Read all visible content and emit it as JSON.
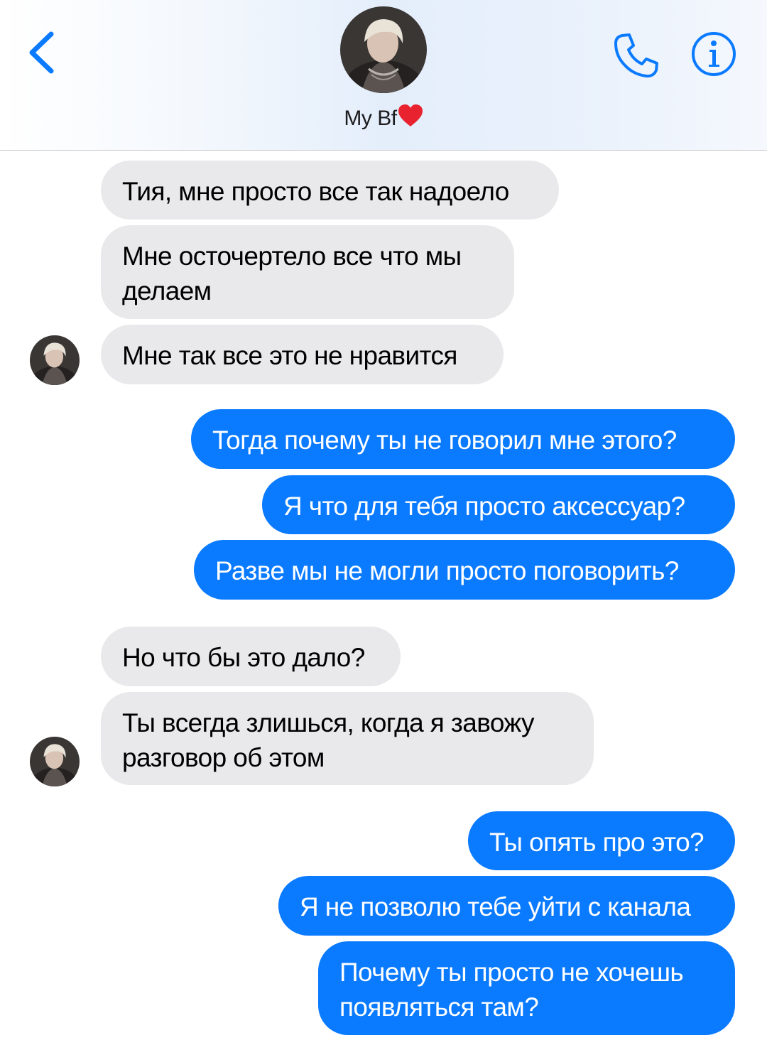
{
  "header": {
    "contact_name": "My Bf",
    "back_icon": "chevron-left-icon",
    "call_icon": "phone-icon",
    "info_icon": "info-icon",
    "accent": "#0a7aff"
  },
  "messages": [
    {
      "from": "contact",
      "text": "Тия, мне просто все так надоело"
    },
    {
      "from": "contact",
      "line1": "Мне осточертело все что мы",
      "line2": "делаем"
    },
    {
      "from": "contact",
      "text": "Мне так все это не нравится"
    },
    {
      "from": "me",
      "text": "Тогда почему ты не говорил мне этого?"
    },
    {
      "from": "me",
      "text": "Я что для тебя просто аксессуар?"
    },
    {
      "from": "me",
      "text": "Разве мы не могли просто поговорить?"
    },
    {
      "from": "contact",
      "text": "Но что бы это дало?"
    },
    {
      "from": "contact",
      "line1": "Ты всегда злишься, когда я завожу",
      "line2": "разговор об этом"
    },
    {
      "from": "me",
      "text": "Ты опять про это?"
    },
    {
      "from": "me",
      "text": "Я не позволю тебе уйти с канала"
    },
    {
      "from": "me",
      "line1": "Почему ты просто не хочешь",
      "line2": "появляться там?"
    }
  ],
  "colors": {
    "incoming_bubble": "#e9e9eb",
    "outgoing_bubble": "#0a7aff"
  }
}
